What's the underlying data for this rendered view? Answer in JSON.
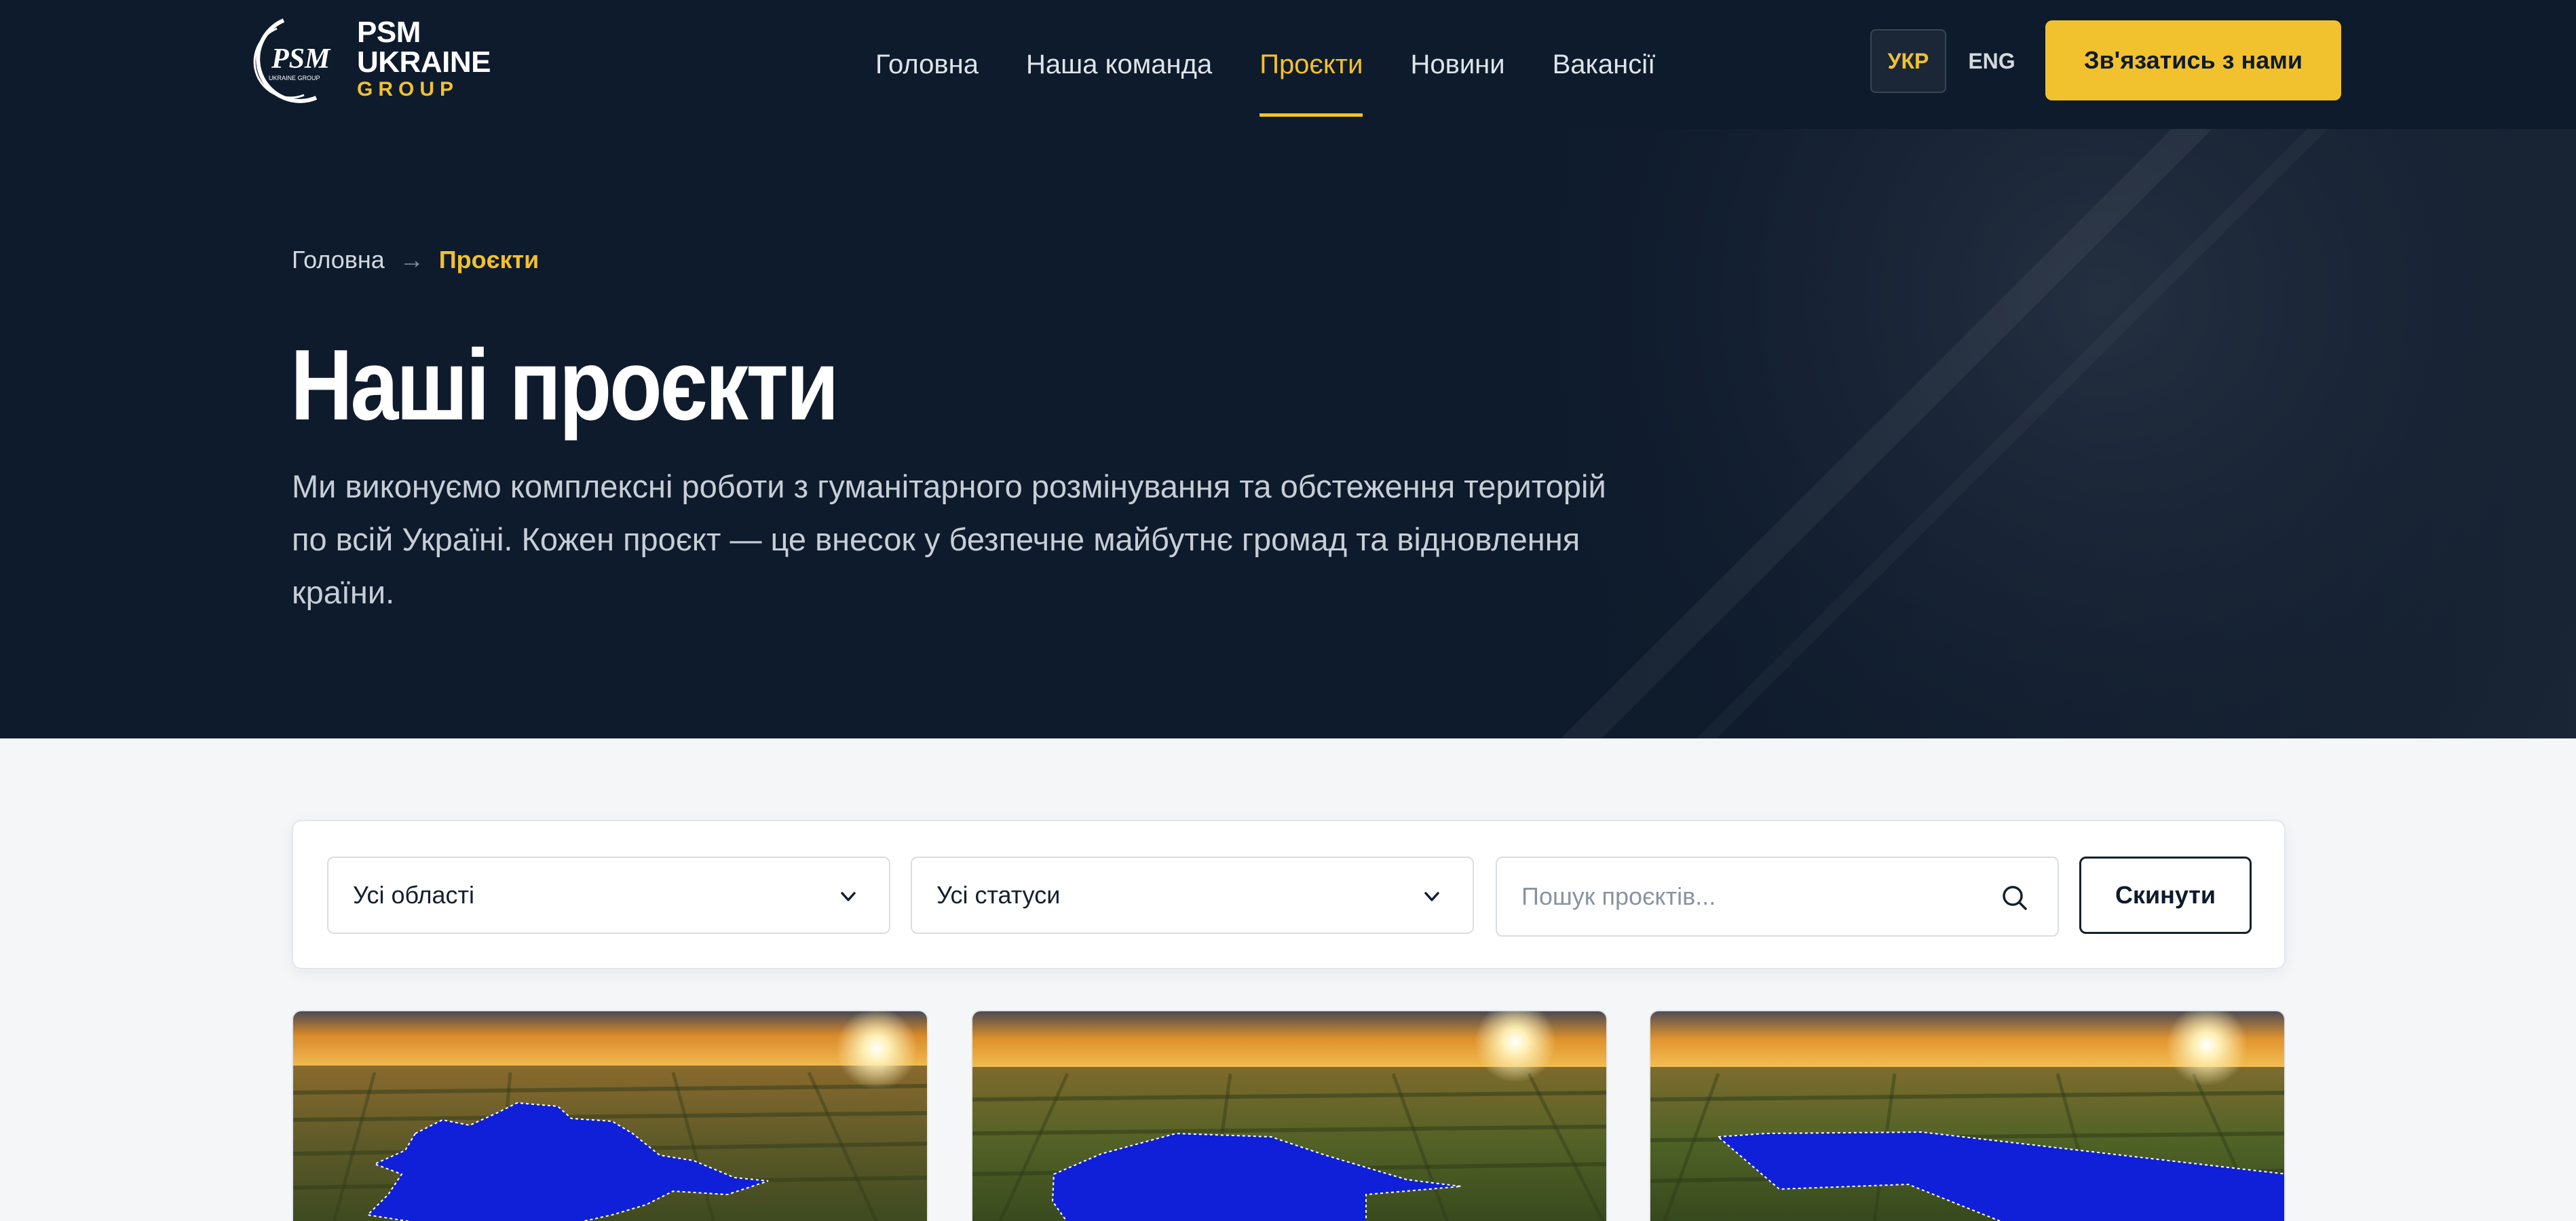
{
  "header": {
    "logo": {
      "mark_text": "PSM",
      "mark_subtext": "UKRAINE GROUP",
      "line1": "PSM",
      "line2": "UKRAINE",
      "line3": "GROUP"
    },
    "nav": [
      {
        "label": "Головна",
        "active": false
      },
      {
        "label": "Наша команда",
        "active": false
      },
      {
        "label": "Проєкти",
        "active": true
      },
      {
        "label": "Новини",
        "active": false
      },
      {
        "label": "Вакансії",
        "active": false
      }
    ],
    "lang": {
      "ukr": "УКР",
      "eng": "ENG",
      "selected": "УКР"
    },
    "cta_label": "Зв'язатись з нами"
  },
  "hero": {
    "breadcrumb": {
      "home": "Головна",
      "separator": "→",
      "current": "Проєкти"
    },
    "title": "Наші проєкти",
    "description": "Ми виконуємо комплексні роботи з гуманітарного розмінування та обстеження територій по всій Україні. Кожен проєкт — це внесок у безпечне майбутнє громад та відновлення країни."
  },
  "filters": {
    "region": {
      "value": "Усі області",
      "icon": "chevron-down-icon"
    },
    "status": {
      "value": "Усі статуси",
      "icon": "chevron-down-icon"
    },
    "search": {
      "placeholder": "Пошук проєктів...",
      "value": "",
      "icon": "search-icon"
    },
    "reset_label": "Скинути"
  },
  "cards": [
    {
      "image": "aerial sunset field with highlighted irregular area"
    },
    {
      "image": "aerial sunset field with highlighted polygon area"
    },
    {
      "image": "aerial sunset field with highlighted L-shaped area"
    }
  ],
  "colors": {
    "navy": "#0e1b2c",
    "accent": "#f2c12e",
    "page_bg": "#f4f6f8",
    "highlight_blue": "#1020d8"
  }
}
